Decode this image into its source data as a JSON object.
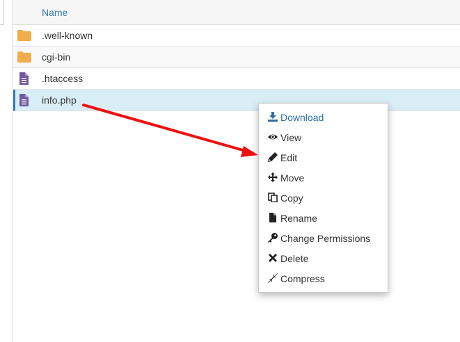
{
  "table": {
    "header": {
      "name": "Name"
    },
    "rows": [
      {
        "name": ".well-known",
        "type": "folder",
        "icon": "folder-icon"
      },
      {
        "name": "cgi-bin",
        "type": "folder",
        "icon": "folder-icon"
      },
      {
        "name": ".htaccess",
        "type": "file",
        "icon": "file-icon"
      },
      {
        "name": "info.php",
        "type": "file",
        "icon": "file-icon",
        "selected": true
      }
    ]
  },
  "context_menu": {
    "items": [
      {
        "label": "Download",
        "icon": "download-icon"
      },
      {
        "label": "View",
        "icon": "eye-icon"
      },
      {
        "label": "Edit",
        "icon": "pencil-icon"
      },
      {
        "label": "Move",
        "icon": "move-icon"
      },
      {
        "label": "Copy",
        "icon": "copy-icon"
      },
      {
        "label": "Rename",
        "icon": "file-icon"
      },
      {
        "label": "Change Permissions",
        "icon": "key-icon"
      },
      {
        "label": "Delete",
        "icon": "close-icon"
      },
      {
        "label": "Compress",
        "icon": "compress-icon"
      }
    ]
  },
  "colors": {
    "link_blue": "#337ab7",
    "folder": "#f0ad4e",
    "file": "#6f5a9e",
    "selected_row": "#d9edf7",
    "annotation_arrow": "#ee1111"
  }
}
